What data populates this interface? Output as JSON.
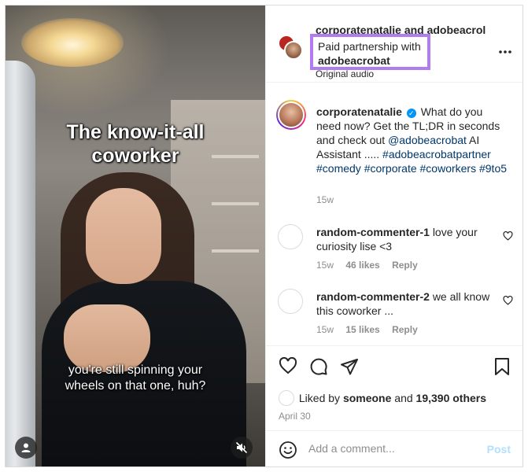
{
  "video": {
    "caption_top_line1": "The know-it-all",
    "caption_top_line2": "coworker",
    "subtitle_line1": "you're still spinning your",
    "subtitle_line2": "wheels on that one, huh?",
    "user_icon": "user-icon",
    "mute_icon": "muted-speaker-icon"
  },
  "header": {
    "usernames": "corporatenatalie and adobeacrol",
    "partnership_prefix": "Paid partnership with",
    "partnership_brand": "adobeacrobat",
    "audio": "Original audio",
    "more_icon": "more-options-icon",
    "highlight_color": "#b07cf0"
  },
  "caption": {
    "username": "corporatenatalie",
    "verified_icon": "verified-badge-icon",
    "text_part1": "What do you need now? Get the TL;DR in seconds and check out",
    "mention": "@adobeacrobat",
    "text_part2": "AI Assistant .....",
    "hashtags": "#adobeacrobatpartner #comedy #corporate #coworkers #9to5",
    "time": "15w"
  },
  "comments": [
    {
      "username": "random-commenter-1",
      "text": "love your curiosity lise <3",
      "time": "15w",
      "likes": "46 likes",
      "reply": "Reply"
    },
    {
      "username": "random-commenter-2",
      "text": "we all know this coworker ...",
      "time": "15w",
      "likes": "15 likes",
      "reply": "Reply"
    }
  ],
  "actions": {
    "like_icon": "heart-icon",
    "comment_icon": "comment-bubble-icon",
    "share_icon": "paper-plane-icon",
    "save_icon": "bookmark-icon",
    "liked_by_prefix": "Liked by",
    "liked_by_user": "someone",
    "and_text": "and",
    "others_count": "19,390 others",
    "date": "April 30"
  },
  "add_comment": {
    "placeholder": "Add a comment...",
    "post_label": "Post",
    "emoji_icon": "emoji-icon"
  },
  "colors": {
    "link": "#00376b",
    "verified": "#0095f6",
    "post_disabled": "#b2dffc",
    "muted_text": "#8e8e8e"
  }
}
